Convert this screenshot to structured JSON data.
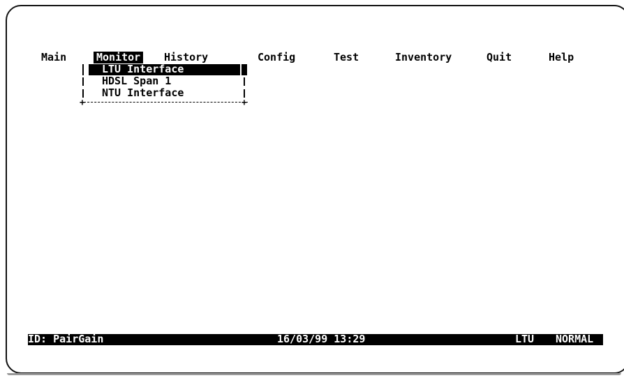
{
  "menu": {
    "items": [
      {
        "label": "Main"
      },
      {
        "label": "Monitor",
        "selected": true
      },
      {
        "label": "History"
      },
      {
        "label": "Config"
      },
      {
        "label": "Test"
      },
      {
        "label": "Inventory"
      },
      {
        "label": "Quit"
      },
      {
        "label": "Help"
      }
    ]
  },
  "dropdown": {
    "items": [
      {
        "label": "LTU Interface",
        "highlighted": true
      },
      {
        "label": "HDSL Span 1"
      },
      {
        "label": "NTU Interface"
      }
    ]
  },
  "status": {
    "id": "ID: PairGain",
    "datetime": "16/03/99 13:29",
    "unit": "LTU",
    "mode": "NORMAL"
  },
  "colors": {
    "background": "#ffffff",
    "foreground": "#000000",
    "highlight_bg": "#000000",
    "highlight_fg": "#ffffff"
  }
}
